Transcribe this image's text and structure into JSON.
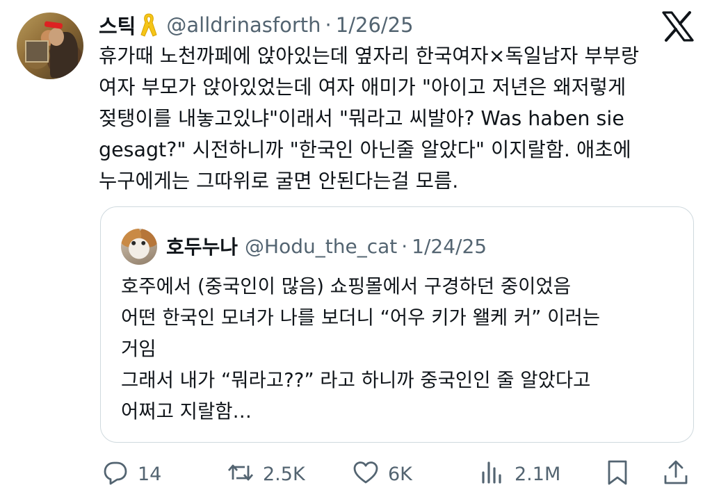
{
  "tweet": {
    "author_name": "스틱",
    "handle": "@alldrinasforth",
    "separator": "·",
    "date": "1/26/25",
    "text": "휴가때 노천까페에 앉아있는데 옆자리 한국여자×독일남자 부부랑\n여자 부모가 앉아있었는데 여자 애미가 \"아이고 저년은 왜저렇게\n젖탱이를 내놓고있냐\"이래서 \"뭐라고 씨발아? Was haben sie\ngesagt?\" 시전하니까 \"한국인 아닌줄 알았다\" 이지랄함. 애초에\n누구에게는 그따위로 굴면 안된다는걸 모름."
  },
  "quoted": {
    "author_name": "호두누나",
    "handle": "@Hodu_the_cat",
    "separator": "·",
    "date": "1/24/25",
    "text": "호주에서 (중국인이 많음) 쇼핑몰에서 구경하던 중이었음\n어떤 한국인 모녀가 나를 보더니 “어우 키가 왤케 커” 이러는\n거임\n그래서 내가 “뭐라고??” 라고 하니까 중국인인 줄 알았다고\n어쩌고 지랄함…"
  },
  "actions": {
    "replies": "14",
    "reposts": "2.5K",
    "likes": "6K",
    "views": "2.1M"
  },
  "icons": {
    "badge": "yellow-ribbon-icon",
    "brand": "x-logo-icon",
    "reply": "reply-bubble-icon",
    "repost": "repost-icon",
    "like": "heart-icon",
    "views": "views-bar-icon",
    "bookmark": "bookmark-icon",
    "share": "share-icon"
  },
  "colors": {
    "text": "#0f1419",
    "secondary": "#536471",
    "border": "#cfd9de",
    "ribbon": "#f5c518"
  }
}
